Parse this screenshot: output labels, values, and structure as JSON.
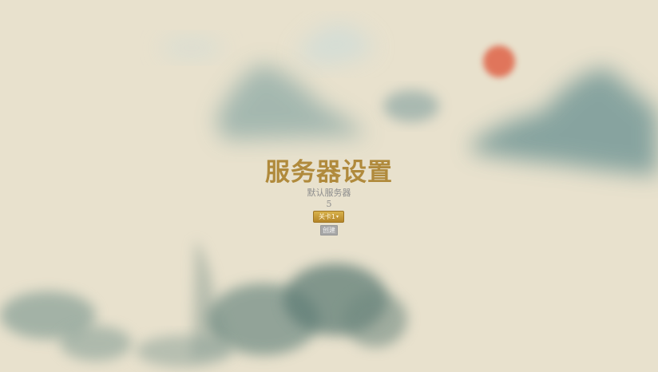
{
  "page": {
    "title": "服务器设置",
    "subtitle": "默认服务器",
    "server_value": "5"
  },
  "controls": {
    "select_label": "关卡1",
    "select_caret": "▾",
    "create_label": "创建"
  },
  "colors": {
    "background": "#e8e1cd",
    "title": "#b08a3c",
    "sun": "#e06a4f",
    "mountain": "#5f8a8c",
    "select_button": "#c89a38",
    "create_button": "#a7a7a7"
  }
}
